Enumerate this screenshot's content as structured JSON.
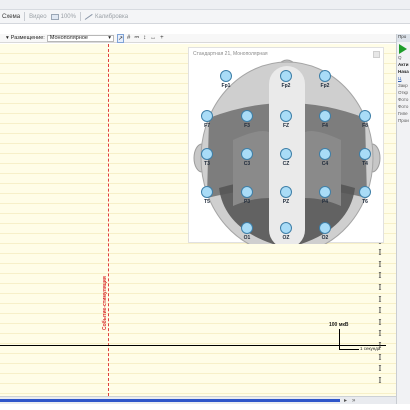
{
  "toolbar": {
    "schema_label": "Схема",
    "video_label": "Видео",
    "zoom_value": "100%",
    "calibration_label": "Калибровка"
  },
  "placement": {
    "label": "Размещение:",
    "value": "Монополярное"
  },
  "tools": {
    "icons": [
      "select-cursor-icon",
      "grid-icon",
      "montage-icon",
      "vertical-measure-icon",
      "horizontal-measure-icon",
      "add-marker-icon"
    ],
    "glyphs": [
      "↗",
      "#",
      "⎓",
      "↕",
      "↔",
      "+"
    ]
  },
  "marker": {
    "label": "Событие-стимуляция",
    "color": "#d92b2b"
  },
  "scale": {
    "amplitude_label": "100 мкВ",
    "time_label": "1 секунда"
  },
  "electrode_map": {
    "title": "Стандартная 21, Монополярная",
    "electrodes": [
      {
        "label": "Fp1"
      },
      {
        "label": "Fp2"
      },
      {
        "label": "Fp2"
      },
      {
        "label": "F7"
      },
      {
        "label": "F3"
      },
      {
        "label": "FZ"
      },
      {
        "label": "F4"
      },
      {
        "label": "F8"
      },
      {
        "label": "T3"
      },
      {
        "label": "C3"
      },
      {
        "label": "CZ"
      },
      {
        "label": "C4"
      },
      {
        "label": "T4"
      },
      {
        "label": "T5"
      },
      {
        "label": "P3"
      },
      {
        "label": "PZ"
      },
      {
        "label": "P4"
      },
      {
        "label": "T6"
      },
      {
        "label": "O1"
      },
      {
        "label": "OZ"
      },
      {
        "label": "O2"
      }
    ]
  },
  "right_panel": {
    "header": "Про",
    "lines": [
      "Q",
      "Акти",
      "Нача",
      "Ц",
      "Закр",
      "Откр",
      "Фото",
      "Фото",
      "Гипе",
      "Прои"
    ]
  },
  "colors": {
    "eeg_background": "#fffde7",
    "gridline": "#efe3a8",
    "play": "#1f9d2a",
    "scroll_thumb": "#2f56c9"
  }
}
